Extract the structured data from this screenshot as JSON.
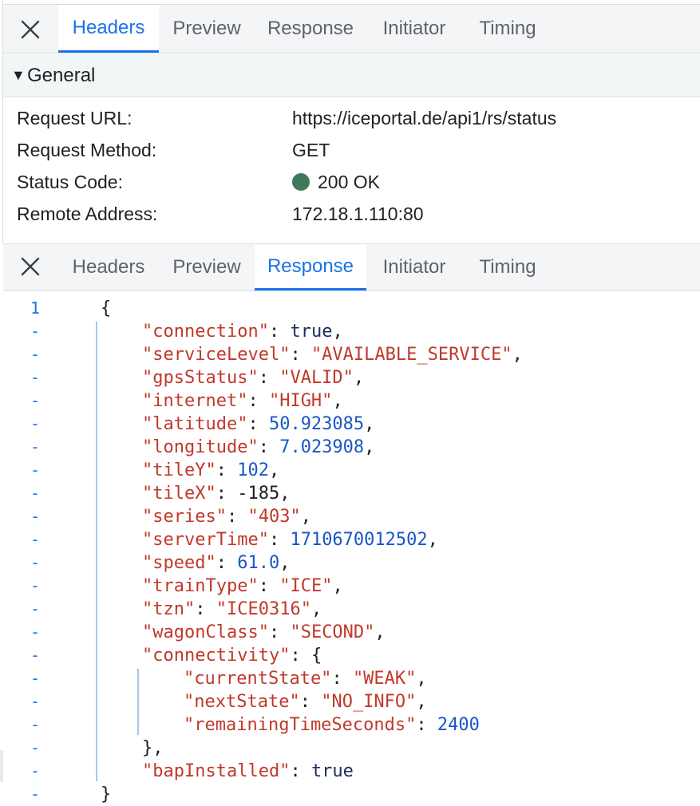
{
  "tabs": [
    "Headers",
    "Preview",
    "Response",
    "Initiator",
    "Timing"
  ],
  "top_panel": {
    "active_tab": "Headers"
  },
  "bottom_panel": {
    "active_tab": "Response"
  },
  "general": {
    "title": "General",
    "rows": [
      {
        "key": "Request URL:",
        "value": "https://iceportal.de/api1/rs/status"
      },
      {
        "key": "Request Method:",
        "value": "GET"
      },
      {
        "key": "Status Code:",
        "value": "200 OK",
        "status_color": "#3d7a5b"
      },
      {
        "key": "Remote Address:",
        "value": "172.18.1.110:80"
      }
    ]
  },
  "response": {
    "first_line_number": "1",
    "continuation_marker": "-",
    "open_brace": "{",
    "close_brace": "}",
    "fields": [
      {
        "key": "connection",
        "value": "true",
        "type": "bool"
      },
      {
        "key": "serviceLevel",
        "value": "AVAILABLE_SERVICE",
        "type": "string"
      },
      {
        "key": "gpsStatus",
        "value": "VALID",
        "type": "string"
      },
      {
        "key": "internet",
        "value": "HIGH",
        "type": "string"
      },
      {
        "key": "latitude",
        "value": "50.923085",
        "type": "number"
      },
      {
        "key": "longitude",
        "value": "7.023908",
        "type": "number"
      },
      {
        "key": "tileY",
        "value": "102",
        "type": "number"
      },
      {
        "key": "tileX",
        "value": "-185",
        "type": "neg"
      },
      {
        "key": "series",
        "value": "403",
        "type": "string"
      },
      {
        "key": "serverTime",
        "value": "1710670012502",
        "type": "number"
      },
      {
        "key": "speed",
        "value": "61.0",
        "type": "number"
      },
      {
        "key": "trainType",
        "value": "ICE",
        "type": "string"
      },
      {
        "key": "tzn",
        "value": "ICE0316",
        "type": "string"
      },
      {
        "key": "wagonClass",
        "value": "SECOND",
        "type": "string"
      },
      {
        "key": "connectivity",
        "type": "object",
        "children": [
          {
            "key": "currentState",
            "value": "WEAK",
            "type": "string"
          },
          {
            "key": "nextState",
            "value": "NO_INFO",
            "type": "string"
          },
          {
            "key": "remainingTimeSeconds",
            "value": "2400",
            "type": "number"
          }
        ]
      },
      {
        "key": "bapInstalled",
        "value": "true",
        "type": "bool"
      }
    ]
  },
  "colors": {
    "accent": "#1a73e8",
    "json_key": "#c0392b",
    "json_string": "#c0392b",
    "json_number": "#1a56c8",
    "json_keyword": "#1e2b5c"
  }
}
